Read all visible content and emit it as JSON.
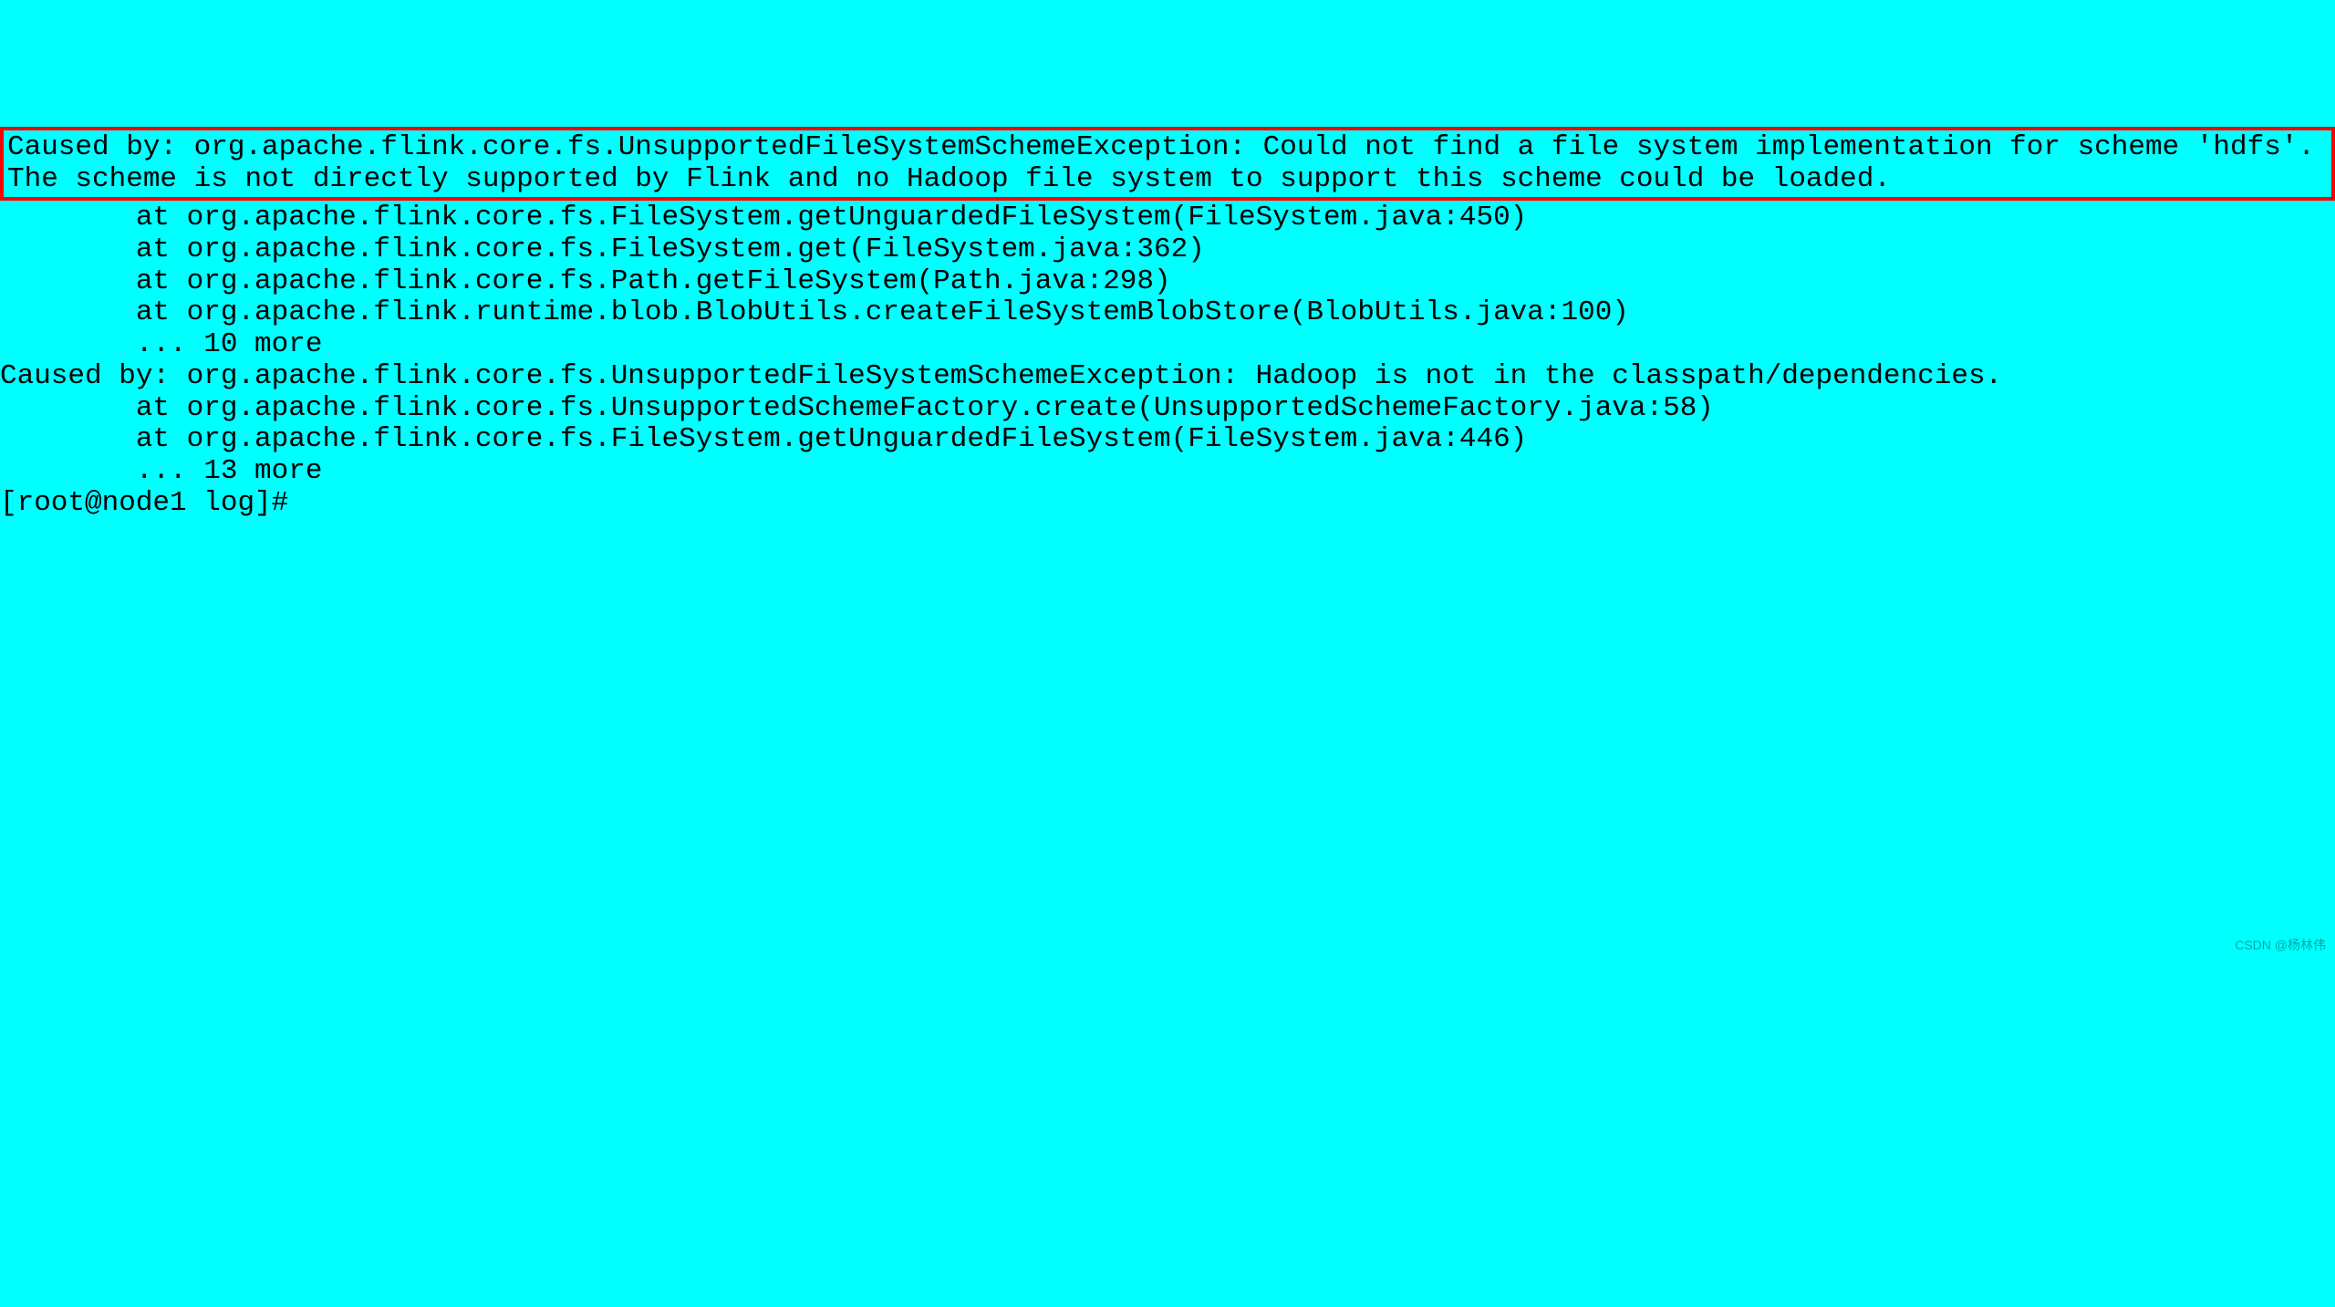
{
  "terminal": {
    "highlighted_error": "Caused by: org.apache.flink.core.fs.UnsupportedFileSystemSchemeException: Could not find a file system implementation for scheme 'hdfs'. The scheme is not directly supported by Flink and no Hadoop file system to support this scheme could be loaded.",
    "stack_lines": [
      "        at org.apache.flink.core.fs.FileSystem.getUnguardedFileSystem(FileSystem.java:450)",
      "        at org.apache.flink.core.fs.FileSystem.get(FileSystem.java:362)",
      "        at org.apache.flink.core.fs.Path.getFileSystem(Path.java:298)",
      "        at org.apache.flink.runtime.blob.BlobUtils.createFileSystemBlobStore(BlobUtils.java:100)",
      "        ... 10 more",
      "Caused by: org.apache.flink.core.fs.UnsupportedFileSystemSchemeException: Hadoop is not in the classpath/dependencies.",
      "        at org.apache.flink.core.fs.UnsupportedSchemeFactory.create(UnsupportedSchemeFactory.java:58)",
      "        at org.apache.flink.core.fs.FileSystem.getUnguardedFileSystem(FileSystem.java:446)",
      "        ... 13 more",
      "[root@node1 log]#"
    ]
  },
  "watermark": "CSDN @杨林伟"
}
